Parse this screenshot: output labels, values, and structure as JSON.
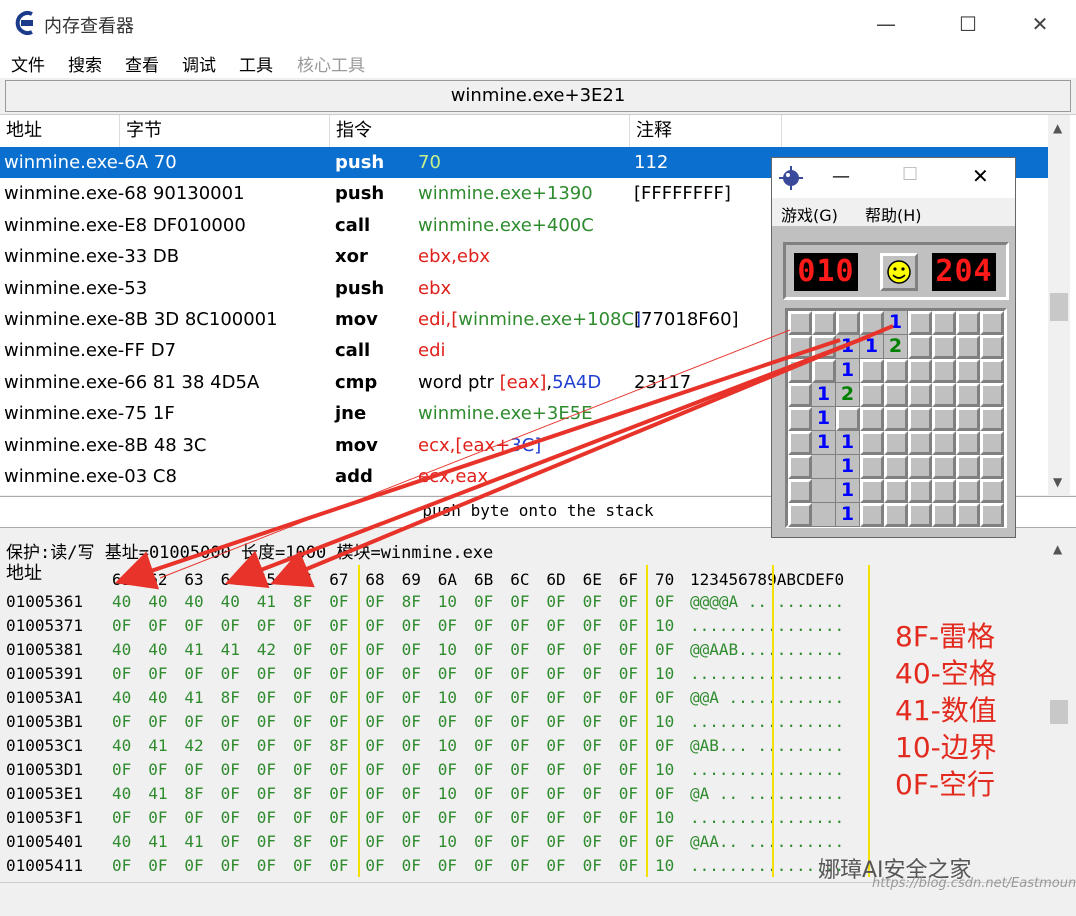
{
  "window": {
    "title": "内存查看器"
  },
  "menu": [
    "文件",
    "搜索",
    "查看",
    "调试",
    "工具",
    "核心工具"
  ],
  "address_bar": "winmine.exe+3E21",
  "disasm": {
    "headers": [
      "地址",
      "字节",
      "指令",
      "注释"
    ],
    "rows": [
      {
        "addr": "winmine.exe-6A 70",
        "op": "push",
        "arg": "70",
        "cmt": "112",
        "selected": true
      },
      {
        "addr": "winmine.exe-68 90130001",
        "op": "push",
        "arg": "winmine.exe+1390",
        "cmt": "[FFFFFFFF]"
      },
      {
        "addr": "winmine.exe-E8 DF010000",
        "op": "call",
        "arg": "winmine.exe+400C",
        "cmt": ""
      },
      {
        "addr": "winmine.exe-33 DB",
        "op": "xor",
        "arg": "ebx,ebx",
        "cmt": ""
      },
      {
        "addr": "winmine.exe-53",
        "op": "push",
        "arg": "ebx",
        "cmt": ""
      },
      {
        "addr": "winmine.exe-8B 3D 8C100001",
        "op": "mov",
        "arg": "edi,[winmine.exe+108C]",
        "cmt": "[77018F60]"
      },
      {
        "addr": "winmine.exe-FF D7",
        "op": "call",
        "arg": "edi",
        "cmt": ""
      },
      {
        "addr": "winmine.exe-66 81 38 4D5A",
        "op": "cmp",
        "arg": "word ptr [eax],5A4D",
        "cmt": "23117"
      },
      {
        "addr": "winmine.exe-75 1F",
        "op": "jne",
        "arg": "winmine.exe+3E5E",
        "cmt": ""
      },
      {
        "addr": "winmine.exe-8B 48 3C",
        "op": "mov",
        "arg": "ecx,[eax+3C]",
        "cmt": ""
      },
      {
        "addr": "winmine.exe-03 C8",
        "op": "add",
        "arg": "ecx,eax",
        "cmt": ""
      }
    ]
  },
  "status_line": "push byte onto the stack",
  "hexinfo": "保护:读/写   基址=01005000 长度=1000 模块=winmine.exe",
  "hex": {
    "address_label": "地址",
    "column_labels": [
      "61",
      "62",
      "63",
      "64",
      "65",
      "66",
      "67",
      "68",
      "69",
      "6A",
      "6B",
      "6C",
      "6D",
      "6E",
      "6F",
      "70"
    ],
    "ascii_header": "123456789ABCDEF0",
    "rows": [
      {
        "addr": "01005361",
        "bytes": [
          "40",
          "40",
          "40",
          "40",
          "41",
          "8F",
          "0F",
          "0F",
          "8F",
          "10",
          "0F",
          "0F",
          "0F",
          "0F",
          "0F",
          "0F"
        ],
        "ascii": "@@@@A .. ......."
      },
      {
        "addr": "01005371",
        "bytes": [
          "0F",
          "0F",
          "0F",
          "0F",
          "0F",
          "0F",
          "0F",
          "0F",
          "0F",
          "0F",
          "0F",
          "0F",
          "0F",
          "0F",
          "0F",
          "10"
        ],
        "ascii": "................"
      },
      {
        "addr": "01005381",
        "bytes": [
          "40",
          "40",
          "41",
          "41",
          "42",
          "0F",
          "0F",
          "0F",
          "0F",
          "10",
          "0F",
          "0F",
          "0F",
          "0F",
          "0F",
          "0F"
        ],
        "ascii": "@@AAB..........."
      },
      {
        "addr": "01005391",
        "bytes": [
          "0F",
          "0F",
          "0F",
          "0F",
          "0F",
          "0F",
          "0F",
          "0F",
          "0F",
          "0F",
          "0F",
          "0F",
          "0F",
          "0F",
          "0F",
          "10"
        ],
        "ascii": "................"
      },
      {
        "addr": "010053A1",
        "bytes": [
          "40",
          "40",
          "41",
          "8F",
          "0F",
          "0F",
          "0F",
          "0F",
          "0F",
          "10",
          "0F",
          "0F",
          "0F",
          "0F",
          "0F",
          "0F"
        ],
        "ascii": "@@A ............"
      },
      {
        "addr": "010053B1",
        "bytes": [
          "0F",
          "0F",
          "0F",
          "0F",
          "0F",
          "0F",
          "0F",
          "0F",
          "0F",
          "0F",
          "0F",
          "0F",
          "0F",
          "0F",
          "0F",
          "10"
        ],
        "ascii": "................"
      },
      {
        "addr": "010053C1",
        "bytes": [
          "40",
          "41",
          "42",
          "0F",
          "0F",
          "0F",
          "8F",
          "0F",
          "0F",
          "10",
          "0F",
          "0F",
          "0F",
          "0F",
          "0F",
          "0F"
        ],
        "ascii": "@AB... ........."
      },
      {
        "addr": "010053D1",
        "bytes": [
          "0F",
          "0F",
          "0F",
          "0F",
          "0F",
          "0F",
          "0F",
          "0F",
          "0F",
          "0F",
          "0F",
          "0F",
          "0F",
          "0F",
          "0F",
          "10"
        ],
        "ascii": "................"
      },
      {
        "addr": "010053E1",
        "bytes": [
          "40",
          "41",
          "8F",
          "0F",
          "0F",
          "8F",
          "0F",
          "0F",
          "0F",
          "10",
          "0F",
          "0F",
          "0F",
          "0F",
          "0F",
          "0F"
        ],
        "ascii": "@A .. .........."
      },
      {
        "addr": "010053F1",
        "bytes": [
          "0F",
          "0F",
          "0F",
          "0F",
          "0F",
          "0F",
          "0F",
          "0F",
          "0F",
          "0F",
          "0F",
          "0F",
          "0F",
          "0F",
          "0F",
          "10"
        ],
        "ascii": "................"
      },
      {
        "addr": "01005401",
        "bytes": [
          "40",
          "41",
          "41",
          "0F",
          "0F",
          "8F",
          "0F",
          "0F",
          "0F",
          "10",
          "0F",
          "0F",
          "0F",
          "0F",
          "0F",
          "0F"
        ],
        "ascii": "@AA.. .........."
      },
      {
        "addr": "01005411",
        "bytes": [
          "0F",
          "0F",
          "0F",
          "0F",
          "0F",
          "0F",
          "0F",
          "0F",
          "0F",
          "0F",
          "0F",
          "0F",
          "0F",
          "0F",
          "0F",
          "10"
        ],
        "ascii": "................"
      }
    ]
  },
  "legend": [
    "8F-雷格",
    "40-空格",
    "41-数值",
    "10-边界",
    "0F-空行"
  ],
  "minesweeper": {
    "menu": [
      "游戏(G)",
      "帮助(H)"
    ],
    "mines_counter": "010",
    "time_counter": "204",
    "grid": [
      [
        "c",
        "c",
        "c",
        "c",
        "1",
        "c",
        "c",
        "c",
        "c"
      ],
      [
        "c",
        "c",
        "1",
        "1",
        "2",
        "c",
        "c",
        "c",
        "c"
      ],
      [
        "c",
        "c",
        "1",
        "c",
        "c",
        "c",
        "c",
        "c",
        "c"
      ],
      [
        "c",
        "1",
        "2",
        "c",
        "c",
        "c",
        "c",
        "c",
        "c"
      ],
      [
        "c",
        "1",
        "c",
        "c",
        "c",
        "c",
        "c",
        "c",
        "c"
      ],
      [
        "c",
        "1",
        "1",
        "c",
        "c",
        "c",
        "c",
        "c",
        "c"
      ],
      [
        "c",
        "",
        "1",
        "c",
        "c",
        "c",
        "c",
        "c",
        "c"
      ],
      [
        "c",
        "",
        "1",
        "c",
        "c",
        "c",
        "c",
        "c",
        "c"
      ],
      [
        "c",
        "",
        "1",
        "c",
        "c",
        "c",
        "c",
        "c",
        "c"
      ]
    ]
  },
  "watermark": "娜璋AI安全之家",
  "watermark_url": "https://blog.csdn.net/Eastmount",
  "colors": {
    "selection": "#0a6fcf",
    "green": "#2e8b2e",
    "red": "#e0201a",
    "blue": "#1f3fd0",
    "legend": "#e32a1e"
  }
}
